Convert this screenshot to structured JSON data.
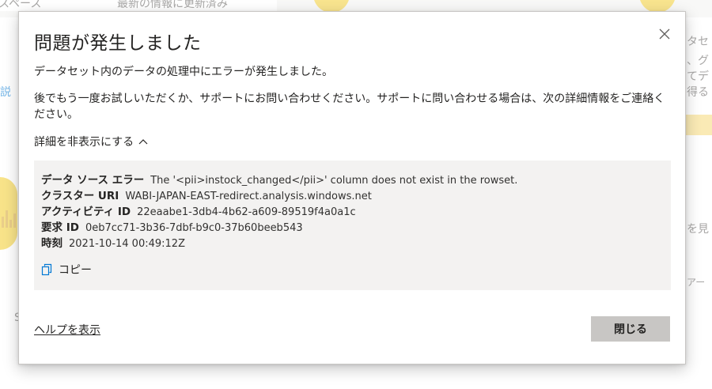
{
  "background": {
    "top_left": "スペース",
    "top_middle": "最新の情報に更新済み",
    "left_link": "説",
    "right_1": "タセ",
    "right_2": "、グ",
    "right_3": "てデ",
    "right_4": "得る",
    "right_5": "を見",
    "right_6": "アー",
    "left_small": "S"
  },
  "dialog": {
    "title": "問題が発生しました",
    "message": "データセット内のデータの処理中にエラーが発生しました。",
    "instruction": "後でもう一度お試しいただくか、サポートにお問い合わせください。サポートに問い合わせる場合は、次の詳細情報をご連絡ください。",
    "toggle_label": "詳細を非表示にする",
    "details": [
      {
        "label": "データ ソース エラー",
        "value": "The '<pii>instock_changed</pii>' column does not exist in the rowset."
      },
      {
        "label": "クラスター URI",
        "value": "WABI-JAPAN-EAST-redirect.analysis.windows.net"
      },
      {
        "label": "アクティビティ ID",
        "value": "22eaabe1-3db4-4b62-a609-89519f4a0a1c"
      },
      {
        "label": "要求 ID",
        "value": "0eb7cc71-3b36-7dbf-b9c0-37b60beeb543"
      },
      {
        "label": "時刻",
        "value": "2021-10-14 00:49:12Z"
      }
    ],
    "copy_label": "コピー",
    "help_link": "ヘルプを表示",
    "close_button": "閉じる"
  },
  "icons": {
    "close": "close-icon",
    "toggle": "chevron-up-icon",
    "copy": "copy-icon"
  },
  "colors": {
    "accent": "#0078d4",
    "close_button_bg": "#c8c6c4",
    "details_bg": "#f3f2f1"
  }
}
